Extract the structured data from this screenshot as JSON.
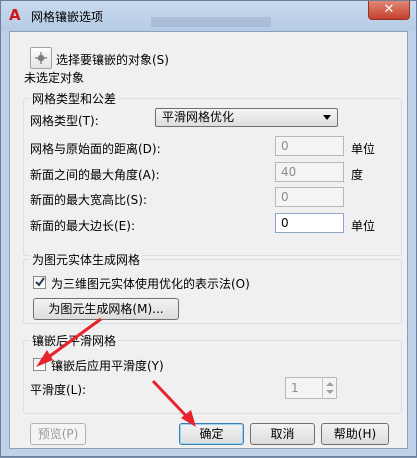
{
  "window": {
    "title": "网格镶嵌选项",
    "close_glyph": "✕",
    "logo_glyph": "A"
  },
  "selection": {
    "button_label": "选择要镶嵌的对象(S)",
    "status": "未选定对象"
  },
  "mesh_group": {
    "title": "网格类型和公差",
    "type_label": "网格类型(T):",
    "type_value": "平滑网格优化",
    "rows": [
      {
        "label": "网格与原始面的距离(D):",
        "value": "0",
        "unit": "单位",
        "enabled": false
      },
      {
        "label": "新面之间的最大角度(A):",
        "value": "40",
        "unit": "度",
        "enabled": false
      },
      {
        "label": "新面的最大宽高比(S):",
        "value": "0",
        "unit": "",
        "enabled": false
      },
      {
        "label": "新面的最大边长(E):",
        "value": "0",
        "unit": "单位",
        "enabled": true
      }
    ]
  },
  "primitive_group": {
    "title": "为图元实体生成网格",
    "checkbox_label": "为三维图元实体使用优化的表示法(O)",
    "checkbox_checked": true,
    "button_label": "为图元生成网格(M)..."
  },
  "smooth_group": {
    "title": "镶嵌后平滑网格",
    "checkbox_label": "镶嵌后应用平滑度(Y)",
    "checkbox_checked": false,
    "level_label": "平滑度(L):",
    "level_value": "1"
  },
  "footer": {
    "preview_label": "预览(P)",
    "ok_label": "确定",
    "cancel_label": "取消",
    "help_label": "帮助(H)"
  },
  "colors": {
    "annotation_red": "#e8232c",
    "title_bar": "#bfd2e8"
  }
}
